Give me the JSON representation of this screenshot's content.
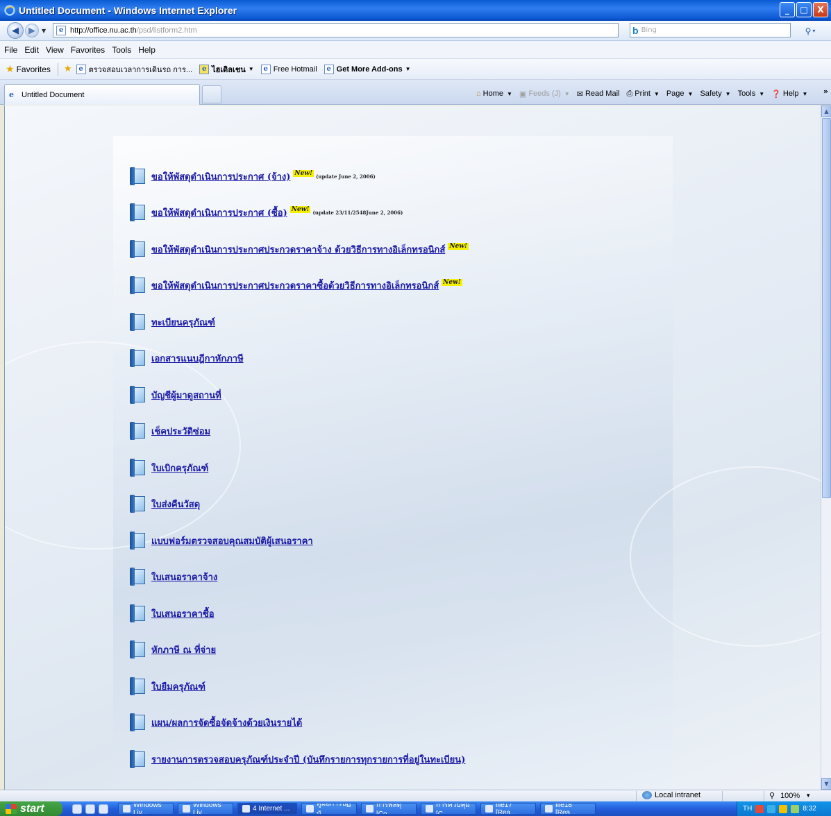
{
  "window": {
    "title": "Untitled Document - Windows Internet Explorer",
    "buttons": {
      "minimize": "_",
      "maximize": "□",
      "close": "X"
    }
  },
  "address_bar": {
    "url_host": "http://office.nu.ac.th",
    "url_path": "/psd/listform2.htm",
    "search_placeholder": "Bing",
    "search_engine_label": "b"
  },
  "menu": [
    "File",
    "Edit",
    "View",
    "Favorites",
    "Tools",
    "Help"
  ],
  "favorites_bar": {
    "label": "Favorites",
    "links": [
      {
        "label": "ตรวจสอบเวลาการเดินรถ การ...",
        "bold": false,
        "dropdown": false
      },
      {
        "label": "ไฮเดิลเชน",
        "bold": true,
        "dropdown": true
      },
      {
        "label": "Free Hotmail",
        "bold": false,
        "dropdown": false
      },
      {
        "label": "Get More Add-ons",
        "bold": true,
        "dropdown": true
      }
    ]
  },
  "tab": {
    "label": "Untitled Document"
  },
  "command_bar": [
    {
      "label": "Home",
      "dropdown": true,
      "disabled": false
    },
    {
      "label": "Feeds (J)",
      "dropdown": true,
      "disabled": true
    },
    {
      "label": "Read Mail",
      "dropdown": false,
      "disabled": false
    },
    {
      "label": "Print",
      "dropdown": true,
      "disabled": false
    },
    {
      "label": "Page",
      "dropdown": true,
      "disabled": false
    },
    {
      "label": "Safety",
      "dropdown": true,
      "disabled": false
    },
    {
      "label": "Tools",
      "dropdown": true,
      "disabled": false
    },
    {
      "label": "Help",
      "dropdown": true,
      "disabled": false
    }
  ],
  "content": {
    "items": [
      {
        "label": "ขอให้พัสดุดำเนินการประกาศ (จ้าง)",
        "badge": "New!",
        "note": "(update June 2, 2006)"
      },
      {
        "label": "ขอให้พัสดุดำเนินการประกาศ (ซื้อ)",
        "badge": "New!",
        "note": "(update 23/11/2548June 2, 2006)"
      },
      {
        "label": "ขอให้พัสดุดำเนินการประกาศประกวดราคาจ้าง ด้วยวิธีการทางอิเล็กทรอนิกส์",
        "badge": "New!",
        "note": ""
      },
      {
        "label": "ขอให้พัสดุดำเนินการประกาศประกวดราคาซื้อด้วยวิธีการทางอิเล็กทรอนิกส์",
        "badge": "New!",
        "note": ""
      },
      {
        "label": "ทะเบียนครุภัณฑ์",
        "badge": "",
        "note": ""
      },
      {
        "label": "เอกสารแนบฎีกาหักภาษี",
        "badge": "",
        "note": ""
      },
      {
        "label": "บัญชีผู้มาดูสถานที่",
        "badge": "",
        "note": ""
      },
      {
        "label": "เช็คประวัติซ่อม",
        "badge": "",
        "note": ""
      },
      {
        "label": "ใบเบิกครุภัณฑ์",
        "badge": "",
        "note": ""
      },
      {
        "label": "ใบส่งคืนวัสดุ",
        "badge": "",
        "note": ""
      },
      {
        "label": "แบบฟอร์มตรวจสอบคุณสมบัติผู้เสนอราคา",
        "badge": "",
        "note": ""
      },
      {
        "label": "ใบเสนอราคาจ้าง",
        "badge": "",
        "note": ""
      },
      {
        "label": "ใบเสนอราคาซื้อ",
        "badge": "",
        "note": ""
      },
      {
        "label": "หักภาษี ณ ที่จ่าย",
        "badge": "",
        "note": ""
      },
      {
        "label": "ใบยืมครุภัณฑ์",
        "badge": "",
        "note": ""
      },
      {
        "label": "แผน/ผลการจัดซื้อจัดจ้างด้วยเงินรายได้",
        "badge": "",
        "note": ""
      },
      {
        "label": "รายงานการตรวจสอบครุภัณฑ์ประจำปี (บันทึกรายการทุกรายการที่อยู่ในทะเบียน)",
        "badge": "",
        "note": ""
      }
    ]
  },
  "status_bar": {
    "zone": "Local intranet",
    "zoom": "100%"
  },
  "taskbar": {
    "start": "start",
    "tasks": [
      {
        "label": "Windows Liv...",
        "active": false
      },
      {
        "label": "Windows Liv...",
        "active": false
      },
      {
        "label": "4 Internet ...",
        "active": true
      },
      {
        "label": "คู่มือการปฏิบั...",
        "active": false
      },
      {
        "label": "การพัสดุ [Co...",
        "active": false
      },
      {
        "label": "การควบคุม [C...",
        "active": false
      },
      {
        "label": "file17 [Rea...",
        "active": false
      },
      {
        "label": "file18 [Rea...",
        "active": false
      }
    ],
    "lang": "TH",
    "clock": "8:32"
  },
  "colors": {
    "link": "#1a1aa6",
    "new_badge": "#f4f000",
    "titlebar": "#0a5bd3"
  }
}
